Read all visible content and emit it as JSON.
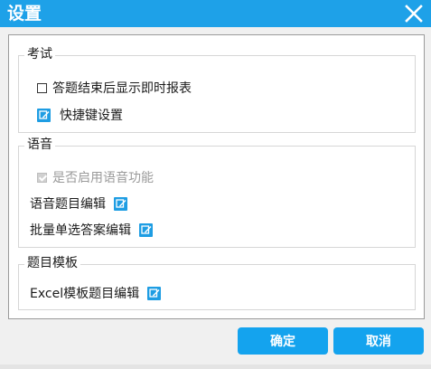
{
  "window": {
    "title": "设置"
  },
  "groups": {
    "exam": {
      "title": "考试",
      "show_report_label": "答题结束后显示即时报表",
      "shortcut_label": "快捷键设置"
    },
    "voice": {
      "title": "语音",
      "enable_voice_label": "是否启用语音功能",
      "voice_question_edit_label": "语音题目编辑",
      "batch_single_answer_edit_label": "批量单选答案编辑"
    },
    "template": {
      "title": "题目模板",
      "excel_template_edit_label": "Excel模板题目编辑"
    }
  },
  "buttons": {
    "ok_label": "确定",
    "cancel_label": "取消"
  },
  "state": {
    "show_report_checked": false,
    "enable_voice_checked": true,
    "enable_voice_disabled": true
  },
  "icons": {
    "close": "close-icon",
    "edit": "edit-icon"
  },
  "colors": {
    "accent": "#1ea1e8",
    "button": "#14a3ee"
  }
}
